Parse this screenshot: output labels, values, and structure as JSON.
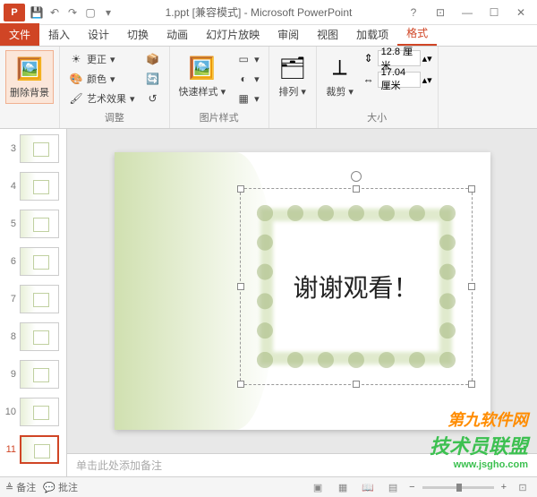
{
  "titlebar": {
    "app_icon": "P",
    "title": "1.ppt [兼容模式] - Microsoft PowerPoint"
  },
  "tabs": {
    "file": "文件",
    "insert": "插入",
    "design": "设计",
    "transitions": "切换",
    "animations": "动画",
    "slideshow": "幻灯片放映",
    "review": "审阅",
    "view": "视图",
    "addins": "加载项",
    "format": "格式"
  },
  "ribbon": {
    "remove_bg": "删除背景",
    "corrections": "更正",
    "color": "颜色",
    "artistic": "艺术效果",
    "adjust_label": "调整",
    "quick_styles": "快速样式",
    "picture_styles_label": "图片样式",
    "arrange": "排列",
    "crop": "裁剪",
    "height": "12.8 厘米",
    "width": "17.04 厘米",
    "size_label": "大小"
  },
  "thumbnails": [
    {
      "num": "3"
    },
    {
      "num": "4"
    },
    {
      "num": "5"
    },
    {
      "num": "6"
    },
    {
      "num": "7"
    },
    {
      "num": "8"
    },
    {
      "num": "9"
    },
    {
      "num": "10"
    },
    {
      "num": "11",
      "active": true
    }
  ],
  "slide": {
    "text": "谢谢观看！"
  },
  "notes": {
    "placeholder": "单击此处添加备注"
  },
  "statusbar": {
    "notes_btn": "备注",
    "comments_btn": "批注"
  },
  "watermark": {
    "line1": "第九软件网",
    "line2": "技术员联盟",
    "url": "www.jsgho.com"
  }
}
